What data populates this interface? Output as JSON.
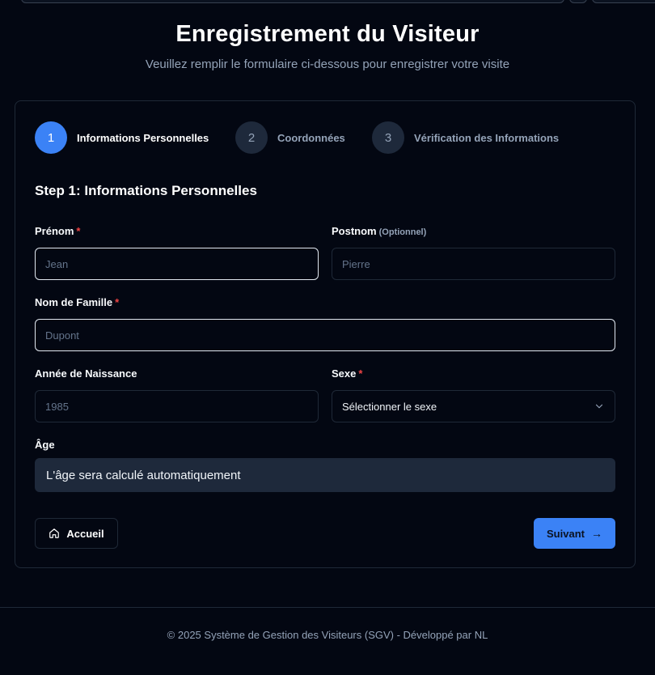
{
  "header": {
    "title": "Enregistrement du Visiteur",
    "subtitle": "Veuillez remplir le formulaire ci-dessous pour enregistrer votre visite"
  },
  "steps": [
    {
      "number": "1",
      "label": "Informations Personnelles",
      "active": true
    },
    {
      "number": "2",
      "label": "Coordonnées",
      "active": false
    },
    {
      "number": "3",
      "label": "Vérification des Informations",
      "active": false
    }
  ],
  "form": {
    "section_title": "Step 1: Informations Personnelles",
    "prenom": {
      "label": "Prénom",
      "required_mark": "*",
      "placeholder": "Jean"
    },
    "postnom": {
      "label": "Postnom",
      "optional_note": "(Optionnel)",
      "placeholder": "Pierre"
    },
    "nom": {
      "label": "Nom de Famille",
      "required_mark": "*",
      "placeholder": "Dupont"
    },
    "annee": {
      "label": "Année de Naissance",
      "placeholder": "1985"
    },
    "sexe": {
      "label": "Sexe",
      "required_mark": "*",
      "value": "Sélectionner le sexe"
    },
    "age": {
      "label": "Âge",
      "value": "L'âge sera calculé automatiquement"
    }
  },
  "buttons": {
    "home_label": "Accueil",
    "next_label": "Suivant",
    "next_arrow": "→"
  },
  "footer": {
    "text": "© 2025 Système de Gestion des Visiteurs (SGV) - Développé par NL"
  },
  "colors": {
    "background": "#030712",
    "accent": "#3b82f6",
    "required": "#ef4444",
    "muted": "#94a3b8"
  }
}
